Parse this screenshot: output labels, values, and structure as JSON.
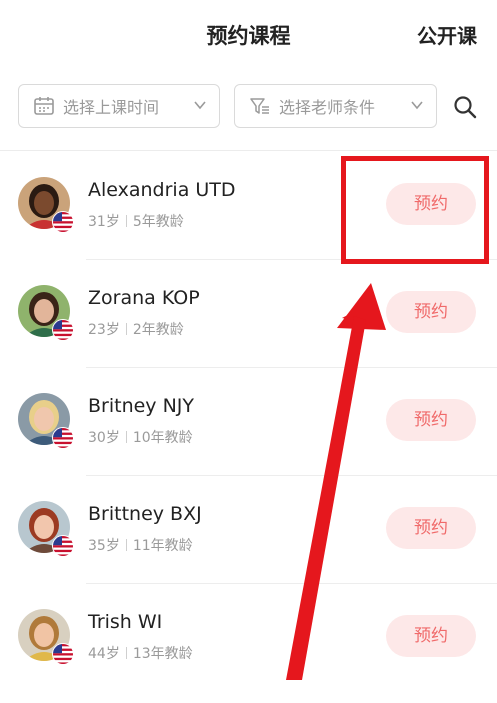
{
  "header": {
    "title": "预约课程",
    "open_class": "公开课"
  },
  "filters": {
    "time": {
      "label": "选择上课时间",
      "icon": "calendar-icon"
    },
    "teacher": {
      "label": "选择老师条件",
      "icon": "filter-icon"
    },
    "search_icon": "search-icon"
  },
  "teachers": [
    {
      "name": "Alexandria UTD",
      "age": "31岁",
      "experience": "5年教龄",
      "book_label": "预约"
    },
    {
      "name": "Zorana KOP",
      "age": "23岁",
      "experience": "2年教龄",
      "book_label": "预约"
    },
    {
      "name": "Britney NJY",
      "age": "30岁",
      "experience": "10年教龄",
      "book_label": "预约"
    },
    {
      "name": "Brittney BXJ",
      "age": "35岁",
      "experience": "11年教龄",
      "book_label": "预约"
    },
    {
      "name": "Trish WI",
      "age": "44岁",
      "experience": "13年教龄",
      "book_label": "预约"
    }
  ],
  "colors": {
    "accent": "#f06a6a",
    "book_bg": "#fde8e8",
    "annotation": "#e5171d"
  },
  "annotation": {
    "highlight": "first-book-button",
    "arrow": "pointing-up"
  }
}
